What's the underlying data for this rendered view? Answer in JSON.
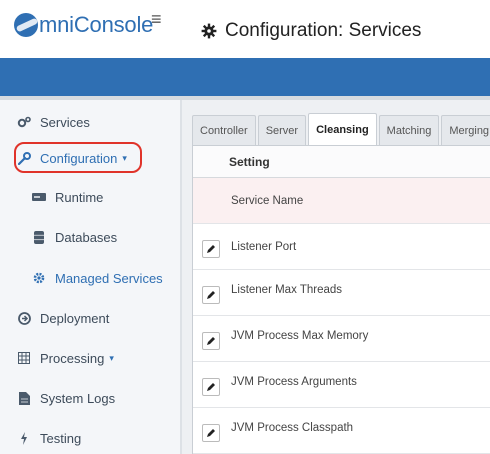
{
  "header": {
    "logo_text": "mniConsole",
    "menu_glyph": "≡",
    "title": "Configuration: Services"
  },
  "sidebar": {
    "items": [
      {
        "label": "Services",
        "icon": "cogs-icon"
      },
      {
        "label": "Configuration",
        "icon": "wrench-icon",
        "caret": "▾"
      },
      {
        "label": "Runtime",
        "icon": "server-icon"
      },
      {
        "label": "Databases",
        "icon": "database-icon"
      },
      {
        "label": "Managed Services",
        "icon": "gear-icon"
      },
      {
        "label": "Deployment",
        "icon": "deploy-icon"
      },
      {
        "label": "Processing",
        "icon": "grid-icon",
        "caret": "▾"
      },
      {
        "label": "System Logs",
        "icon": "document-icon"
      },
      {
        "label": "Testing",
        "icon": "bolt-icon"
      }
    ]
  },
  "tabs": [
    "Controller",
    "Server",
    "Cleansing",
    "Matching",
    "Merging"
  ],
  "active_tab": "Cleansing",
  "table": {
    "header": "Setting",
    "rows": [
      {
        "label": "Service Name",
        "editable": false
      },
      {
        "label": "Listener Port",
        "editable": true
      },
      {
        "label": "Listener Max Threads",
        "editable": true
      },
      {
        "label": "JVM Process Max Memory",
        "editable": true
      },
      {
        "label": "JVM Process Arguments",
        "editable": true
      },
      {
        "label": "JVM Process Classpath",
        "editable": true
      }
    ]
  },
  "colors": {
    "brand_blue": "#2f6fb3",
    "highlight_red": "#e0332a"
  }
}
